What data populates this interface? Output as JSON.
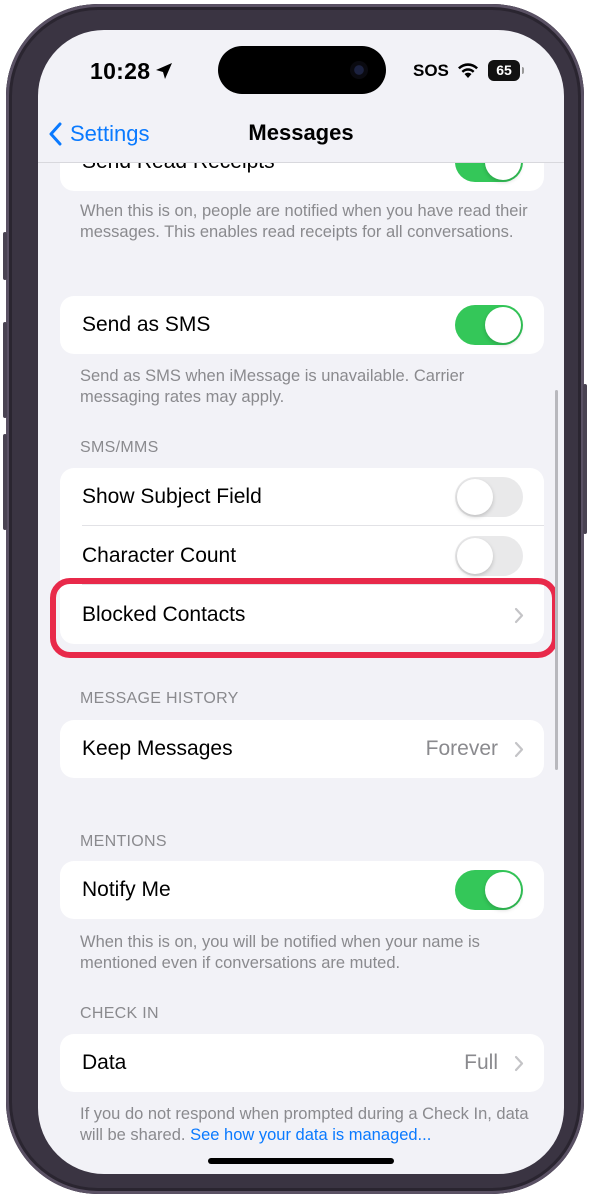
{
  "status_bar": {
    "time": "10:28",
    "carrier": "SOS",
    "battery": "65",
    "icons": [
      "location-arrow-icon",
      "wifi-icon",
      "battery-icon"
    ]
  },
  "nav": {
    "back_label": "Settings",
    "title": "Messages"
  },
  "sections": {
    "read_receipts": {
      "label": "Send Read Receipts",
      "toggle_on": true,
      "footer": "When this is on, people are notified when you have read their messages. This enables read receipts for all conversations."
    },
    "send_as_sms": {
      "label": "Send as SMS",
      "toggle_on": true,
      "footer": "Send as SMS when iMessage is unavailable. Carrier messaging rates may apply."
    },
    "sms_mms": {
      "header": "SMS/MMS",
      "rows": [
        {
          "label": "Show Subject Field",
          "toggle_on": false
        },
        {
          "label": "Character Count",
          "toggle_on": false
        },
        {
          "label": "Blocked Contacts"
        }
      ]
    },
    "message_history": {
      "header": "MESSAGE HISTORY",
      "keep_messages": {
        "label": "Keep Messages",
        "value": "Forever"
      }
    },
    "mentions": {
      "header": "MENTIONS",
      "notify_me": {
        "label": "Notify Me",
        "toggle_on": true
      },
      "footer": "When this is on, you will be notified when your name is mentioned even if conversations are muted."
    },
    "check_in": {
      "header": "CHECK IN",
      "data": {
        "label": "Data",
        "value": "Full"
      },
      "footer_text": "If you do not respond when prompted during a Check In, data will be shared.",
      "footer_link": "See how your data is managed..."
    }
  },
  "colors": {
    "accent": "#0a7aff",
    "toggle_on": "#34c759",
    "toggle_off": "#e9e9ea",
    "highlight": "#e8294a",
    "background": "#f2f2f7"
  }
}
